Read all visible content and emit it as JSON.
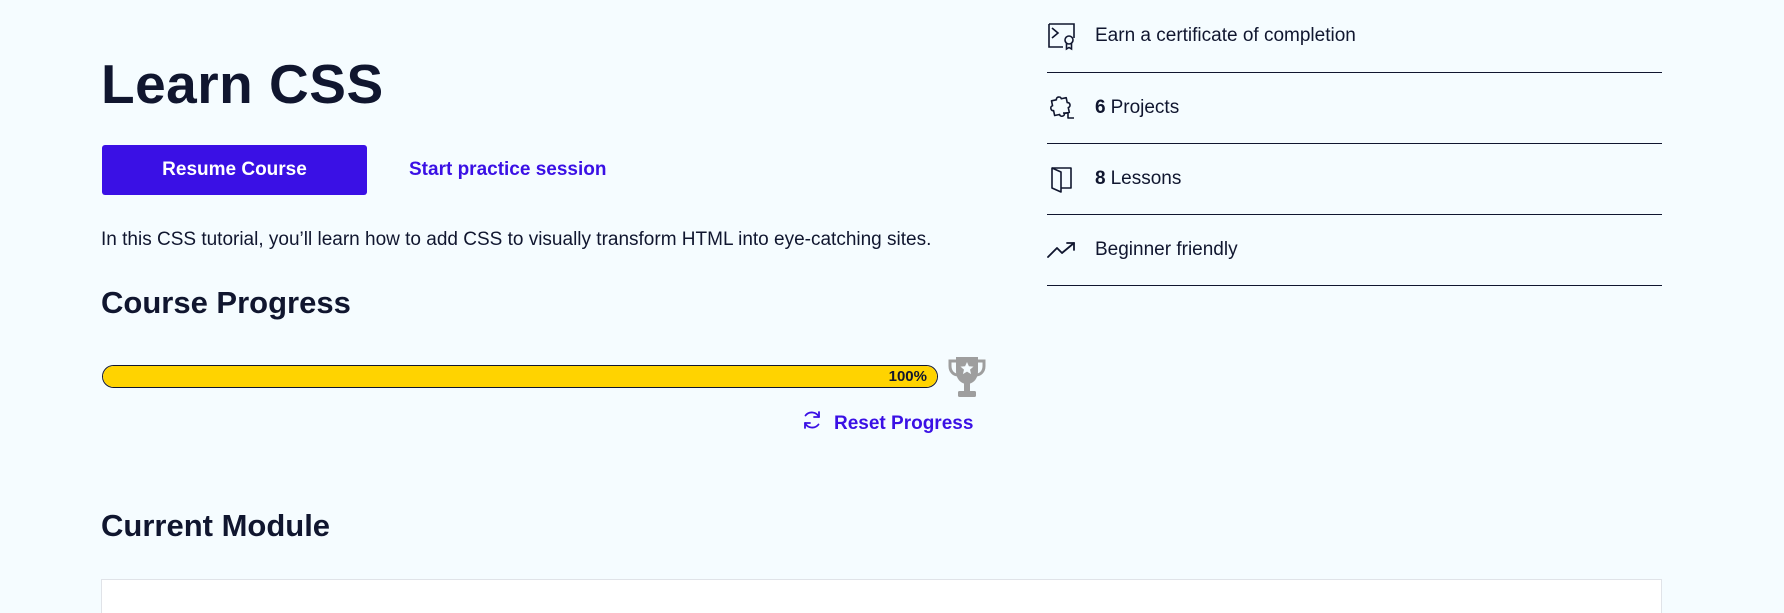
{
  "course": {
    "title": "Learn CSS",
    "resume_label": "Resume Course",
    "practice_label": "Start practice session",
    "description": "In this CSS tutorial, you’ll learn how to add CSS to visually transform HTML into eye-catching sites."
  },
  "progress": {
    "heading": "Course Progress",
    "value": 1.0,
    "label": "100%",
    "reset_label": "Reset Progress",
    "bar_color": "#ffd300"
  },
  "module": {
    "heading": "Current Module"
  },
  "features": [
    {
      "icon": "certificate-icon",
      "number": "",
      "text": "Earn a certificate of completion"
    },
    {
      "icon": "puzzle-icon",
      "number": "6",
      "text": "Projects"
    },
    {
      "icon": "book-icon",
      "number": "8",
      "text": "Lessons"
    },
    {
      "icon": "trend-up-icon",
      "number": "",
      "text": "Beginner friendly"
    }
  ],
  "colors": {
    "accent": "#3a10e5",
    "text": "#10162f",
    "background": "#f5fcff",
    "trophy": "#9e9e9e"
  }
}
